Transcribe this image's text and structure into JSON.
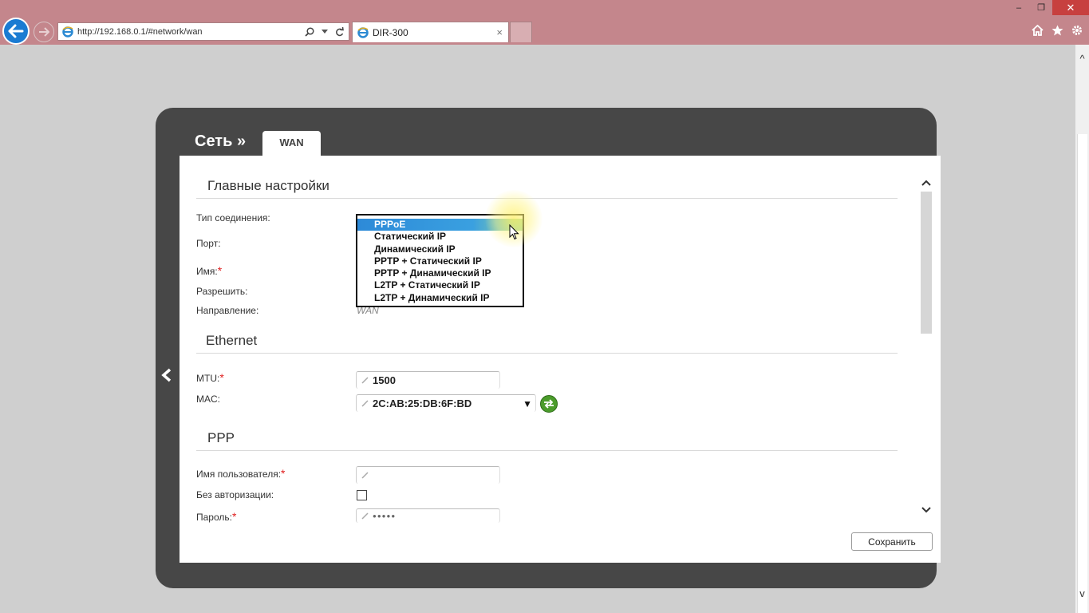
{
  "browser": {
    "url": "http://192.168.0.1/#network/wan",
    "tab_title": "DIR-300",
    "tab_close": "×",
    "window_controls": [
      "–",
      "❐",
      "✕"
    ]
  },
  "panel": {
    "breadcrumb": "Сеть »",
    "active_tab": "WAN"
  },
  "sections": {
    "main": "Главные настройки",
    "ethernet": "Ethernet",
    "ppp": "PPP"
  },
  "fields": {
    "connection_type": "Тип соединения:",
    "port": "Порт:",
    "name": "Имя:",
    "allow": "Разрешить:",
    "direction": "Направление:",
    "direction_value": "WAN",
    "mtu": "MTU:",
    "mtu_value": "1500",
    "mac": "MAC:",
    "mac_value": "2C:AB:25:DB:6F:BD",
    "username": "Имя пользователя:",
    "no_auth": "Без авторизации:",
    "password": "Пароль:",
    "password_value": "●●●●●",
    "required_mark": "*"
  },
  "dropdown": {
    "options": [
      "PPPoE",
      "Статический IP",
      "Динамический IP",
      "PPTP + Статический IP",
      "PPTP + Динамический IP",
      "L2TP + Статический IP",
      "L2TP + Динамический IP"
    ],
    "selected_index": 0
  },
  "buttons": {
    "save": "Сохранить"
  },
  "colors": {
    "chrome": "#c4868c",
    "panel": "#474747",
    "selected_option": "#2d8ad8",
    "required": "#e02020"
  }
}
